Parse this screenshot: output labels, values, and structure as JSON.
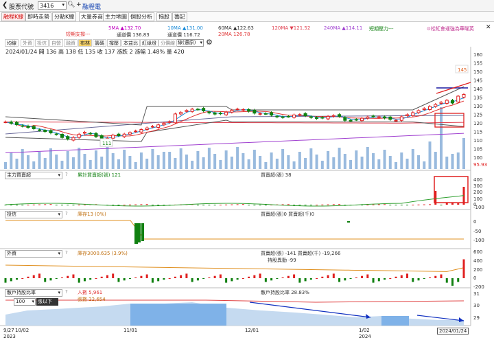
{
  "header": {
    "title": "股票代號",
    "stock_code": "3416",
    "stock_name": "融程電"
  },
  "tabs": [
    {
      "label": "融程K線",
      "active": true
    },
    {
      "label": "即時走勢"
    },
    {
      "label": "分點K線"
    },
    {
      "label": "大量券商"
    },
    {
      "label": "主力地圖"
    },
    {
      "label": "個股分析"
    },
    {
      "label": "揭股"
    },
    {
      "label": "籌記"
    }
  ],
  "promo_text": "⊙松紅會運強為華曜英",
  "ma_legend": {
    "short_support": "短期支撐---",
    "ma5": "5MA ▲132.70",
    "ma10": "10MA ▲131.00",
    "ma60": "60MA ▲122.63",
    "ma120": "120MA ▼121.52",
    "ma240": "240MA ▲114.11",
    "short_pressure": "短期壓力---",
    "ch1": "通道價 136.83",
    "ch2": "通道價 116.72",
    "ma20": "20MA 126.78"
  },
  "toolbar": {
    "buttons": [
      "均線",
      "外資",
      "投信",
      "自營",
      "融資",
      "布林",
      "籌碼",
      "撐壓",
      "本益比",
      "紅綠燈",
      "分價線"
    ],
    "selected": "布林",
    "active": [
      "均線",
      "布林",
      "籌碼",
      "撐壓",
      "本益比",
      "紅綠燈"
    ],
    "period": "日線(還原)"
  },
  "info_line": "2024/01/24 開 136 高 138 低 135 收 137  漲跌 2  漲幅 1.48%  量 420",
  "main_axis": [
    "160",
    "155",
    "150",
    "145",
    "140",
    "135",
    "130",
    "125",
    "120",
    "115",
    "110",
    "105",
    "100"
  ],
  "price_high_label": "145",
  "price_low_label": "111",
  "last_price_label": "95.93",
  "panel1": {
    "select": "主力買賣超",
    "help": "?",
    "cum": "累計買賣超(張) 121",
    "daily": "買賣超(張) 38",
    "axis": [
      "400",
      "300",
      "200",
      "100",
      "0",
      "-100"
    ]
  },
  "panel2": {
    "select": "投信",
    "help": "?",
    "hold": "庫存13 (0%)",
    "daily": "買賣超(張)0 買賣超(千)0",
    "axis": [
      "0",
      "-50",
      "-100"
    ]
  },
  "panel3": {
    "select": "外資",
    "help": "?",
    "hold": "庫存3000.635 (3.9%)",
    "daily": "買賣超(張) -141 買賣超(千) -19,266",
    "extra": "持股異動 -99",
    "axis": [
      "600",
      "400",
      "200",
      "0",
      "-200"
    ]
  },
  "panel4": {
    "select": "散戶持股比率",
    "help": "?",
    "option": "100",
    "option2": "張以下",
    "people": "人數 5,961",
    "shares": "張數 22,654",
    "ratio": "散戶持股比率 28.83%",
    "axis": [
      "31",
      "30",
      "29"
    ]
  },
  "xaxis": {
    "d1": "9/27",
    "d2": "10/02",
    "y1": "2023",
    "d3": "11/01",
    "d4": "12/01",
    "d5": "1/02",
    "y2": "2024",
    "d6": "2024/01/24"
  },
  "colors": {
    "up": "#e02020",
    "down": "#108010",
    "ma5": "#c000c0",
    "ma10": "#1a8bd8",
    "ma20": "#e03030",
    "ma60": "#6a6a9a",
    "ma120": "#e04050",
    "ma240": "#a040d0",
    "vol": "#7fa9d6",
    "annot": "#e02020",
    "arrow": "#1030c0"
  }
}
